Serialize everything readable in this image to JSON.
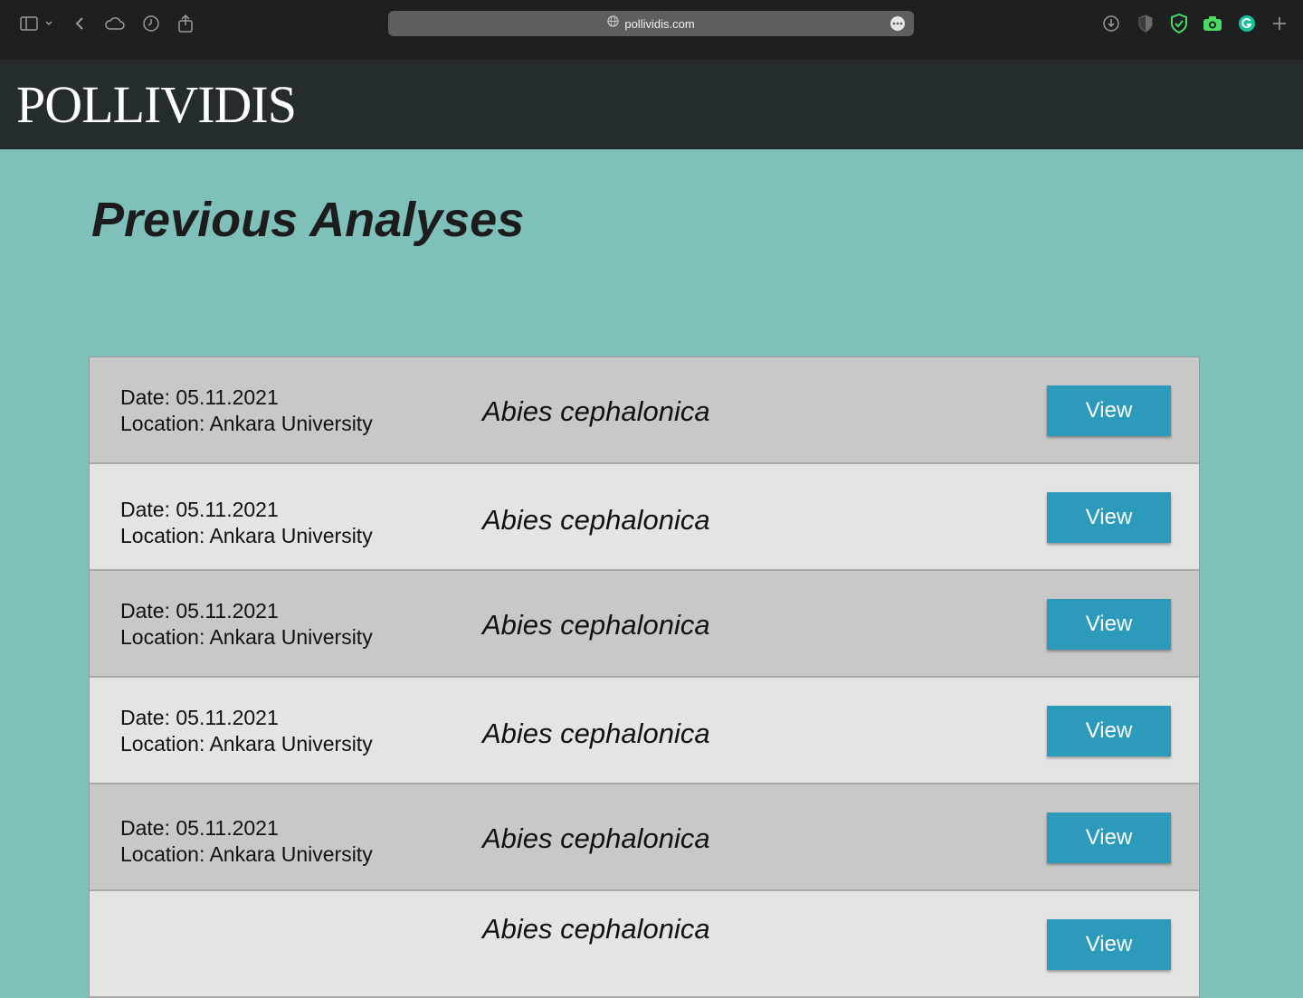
{
  "browser": {
    "url": "pollividis.com",
    "toolbar_icons": [
      "sidebar-icon",
      "chevron-down-icon",
      "back-icon",
      "cloud-icon",
      "history-icon",
      "share-icon"
    ],
    "extension_icons": [
      "download-icon",
      "privacy-shield-icon",
      "adguard-icon",
      "camera-icon",
      "grammarly-icon",
      "new-tab-icon"
    ]
  },
  "site": {
    "logo": "POLLIVIDIS"
  },
  "main": {
    "title": "Previous Analyses",
    "analyses": [
      {
        "date_line": "Date: 05.11.2021",
        "location_line": "Location: Ankara University",
        "species": "Abies cephalonica",
        "button": "View"
      },
      {
        "date_line": "Date: 05.11.2021",
        "location_line": "Location: Ankara University",
        "species": "Abies cephalonica",
        "button": "View"
      },
      {
        "date_line": "Date: 05.11.2021",
        "location_line": "Location: Ankara University",
        "species": "Abies cephalonica",
        "button": "View"
      },
      {
        "date_line": "Date: 05.11.2021",
        "location_line": "Location: Ankara University",
        "species": "Abies cephalonica",
        "button": "View"
      },
      {
        "date_line": "Date: 05.11.2021",
        "location_line": "Location: Ankara University",
        "species": "Abies cephalonica",
        "button": "View"
      },
      {
        "date_line": "",
        "location_line": "",
        "species": "Abies cephalonica",
        "button": "View"
      }
    ]
  },
  "colors": {
    "page_background": "#80c0ba",
    "header_background": "#242c2f",
    "button": "#2c9abb",
    "row_dark": "#c8c8c8",
    "row_light": "#e4e4e4"
  }
}
